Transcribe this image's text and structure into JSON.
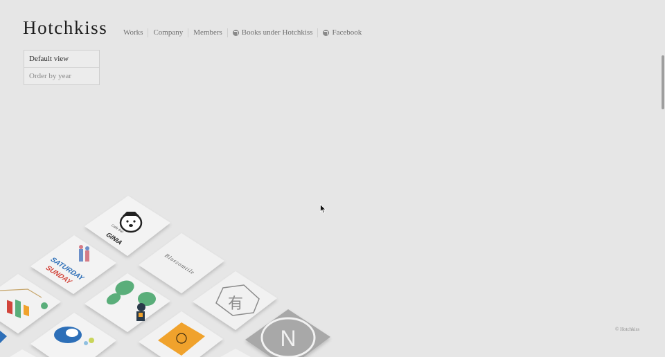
{
  "header": {
    "logo": "Hotchkiss",
    "nav": [
      {
        "label": "Works",
        "external": false
      },
      {
        "label": "Company",
        "external": false
      },
      {
        "label": "Members",
        "external": false
      },
      {
        "label": "Books under Hotchkiss",
        "external": true
      },
      {
        "label": "Facebook",
        "external": true
      }
    ]
  },
  "views": {
    "options": [
      {
        "label": "Default view",
        "active": true
      },
      {
        "label": "Order by year",
        "active": false
      }
    ]
  },
  "tiles": [
    {
      "id": "ginia",
      "text": "GINIA",
      "small": "Cafe Bar",
      "color": "#f3f3f3"
    },
    {
      "id": "saturday-sunday",
      "lines": [
        "SATURDAY",
        "SUNDAY"
      ],
      "color": "#f3f3f3"
    },
    {
      "id": "blossomtile",
      "text": "Blossomtile",
      "color": "#f1f1f1"
    },
    {
      "id": "infographic",
      "color": "#f2f2f2"
    },
    {
      "id": "leaves",
      "color": "#f3f3f3"
    },
    {
      "id": "yu",
      "text": "有",
      "color": "#f1f1f1"
    },
    {
      "id": "matryoshka",
      "color": "#f3f3f3"
    },
    {
      "id": "orange-book",
      "color": "#f2f2f2"
    },
    {
      "id": "n-logo",
      "text": "N",
      "color": "#a8a8a8"
    }
  ],
  "footer": {
    "copyright": "© Hotchkiss"
  },
  "colors": {
    "background": "#e6e6e6",
    "accent_orange": "#f0a22c",
    "accent_green": "#5aae7a",
    "accent_blue": "#2d6fb8",
    "accent_red": "#d2453b"
  }
}
